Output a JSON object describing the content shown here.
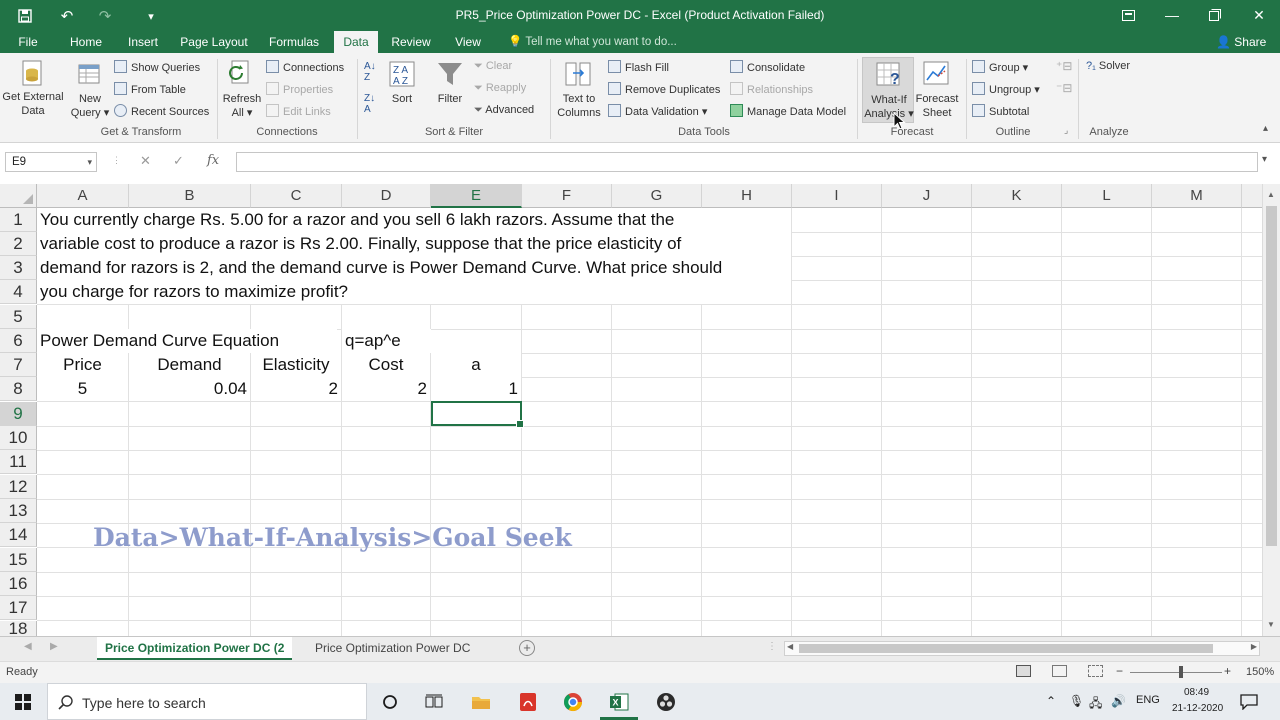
{
  "window": {
    "title": "PR5_Price Optimization Power DC  -  Excel (Product Activation Failed)",
    "quick_access": [
      "save-icon",
      "undo-icon",
      "redo-icon",
      "customize-icon"
    ],
    "controls": [
      "ribbon-display-icon",
      "minimize-icon",
      "restore-icon",
      "close-icon"
    ]
  },
  "menu": {
    "tabs": [
      "File",
      "Home",
      "Insert",
      "Page Layout",
      "Formulas",
      "Data",
      "Review",
      "View"
    ],
    "active_tab": "Data",
    "tell_me": "Tell me what you want to do...",
    "share": "Share"
  },
  "ribbon": {
    "get_transform": {
      "get_external": "Get External",
      "data": "Data",
      "new": "New",
      "query": "Query",
      "show_queries": "Show Queries",
      "from_table": "From Table",
      "recent_sources": "Recent Sources",
      "label": "Get & Transform"
    },
    "connections": {
      "refresh": "Refresh",
      "all": "All",
      "connections": "Connections",
      "properties": "Properties",
      "edit_links": "Edit Links",
      "label": "Connections"
    },
    "sort_filter": {
      "sort": "Sort",
      "filter": "Filter",
      "clear": "Clear",
      "reapply": "Reapply",
      "advanced": "Advanced",
      "label": "Sort & Filter"
    },
    "data_tools": {
      "text_to": "Text to",
      "columns": "Columns",
      "flash_fill": "Flash Fill",
      "remove_duplicates": "Remove Duplicates",
      "data_validation": "Data Validation",
      "consolidate": "Consolidate",
      "relationships": "Relationships",
      "manage_data_model": "Manage Data Model",
      "label": "Data Tools"
    },
    "forecast": {
      "what_if": "What-If",
      "analysis": "Analysis",
      "forecast": "Forecast",
      "sheet": "Sheet",
      "label": "Forecast"
    },
    "outline": {
      "group": "Group",
      "ungroup": "Ungroup",
      "subtotal": "Subtotal",
      "label": "Outline"
    },
    "analyze": {
      "solver": "Solver",
      "label": "Analyze"
    }
  },
  "formula_bar": {
    "name_box": "E9",
    "cancel": "✕",
    "enter": "✓",
    "fx": "fx",
    "formula": ""
  },
  "sheet": {
    "columns": [
      "A",
      "B",
      "C",
      "D",
      "E",
      "F",
      "G",
      "H",
      "I",
      "J",
      "K",
      "L",
      "M"
    ],
    "rows": [
      "1",
      "2",
      "3",
      "4",
      "5",
      "6",
      "7",
      "8",
      "9",
      "10",
      "11",
      "12",
      "13",
      "14",
      "15",
      "16",
      "17",
      "18"
    ],
    "selected_cell": "E9",
    "problem_lines": [
      "You currently charge Rs. 5.00 for a razor and you sell 6 lakh razors. Assume that the",
      "variable cost to produce a razor is Rs 2.00. Finally, suppose that the price elasticity of",
      "demand for razors is 2, and the demand curve is Power Demand Curve. What price should",
      "you charge for razors to maximize profit?"
    ],
    "equation_label": "Power Demand Curve Equation",
    "equation": "q=ap^e",
    "headers": [
      "Price",
      "Demand",
      "Elasticity",
      "Cost",
      "a"
    ],
    "values": [
      "5",
      "0.04",
      "2",
      "2",
      "1"
    ]
  },
  "overlay_text": "Data>What-If-Analysis>Goal Seek",
  "sheet_tabs": [
    "Price Optimization Power DC (2",
    "Price Optimization Power DC"
  ],
  "active_sheet": "Price Optimization Power DC (2",
  "status": {
    "ready": "Ready",
    "zoom": "150%"
  },
  "taskbar": {
    "search_placeholder": "Type here to search",
    "language": "ENG",
    "time": "08:49",
    "date": "21-12-2020"
  },
  "colors": {
    "excel_green": "#217346",
    "overlay_text": "#8e9ccc",
    "ribbon_bg": "#f3f3f3"
  }
}
